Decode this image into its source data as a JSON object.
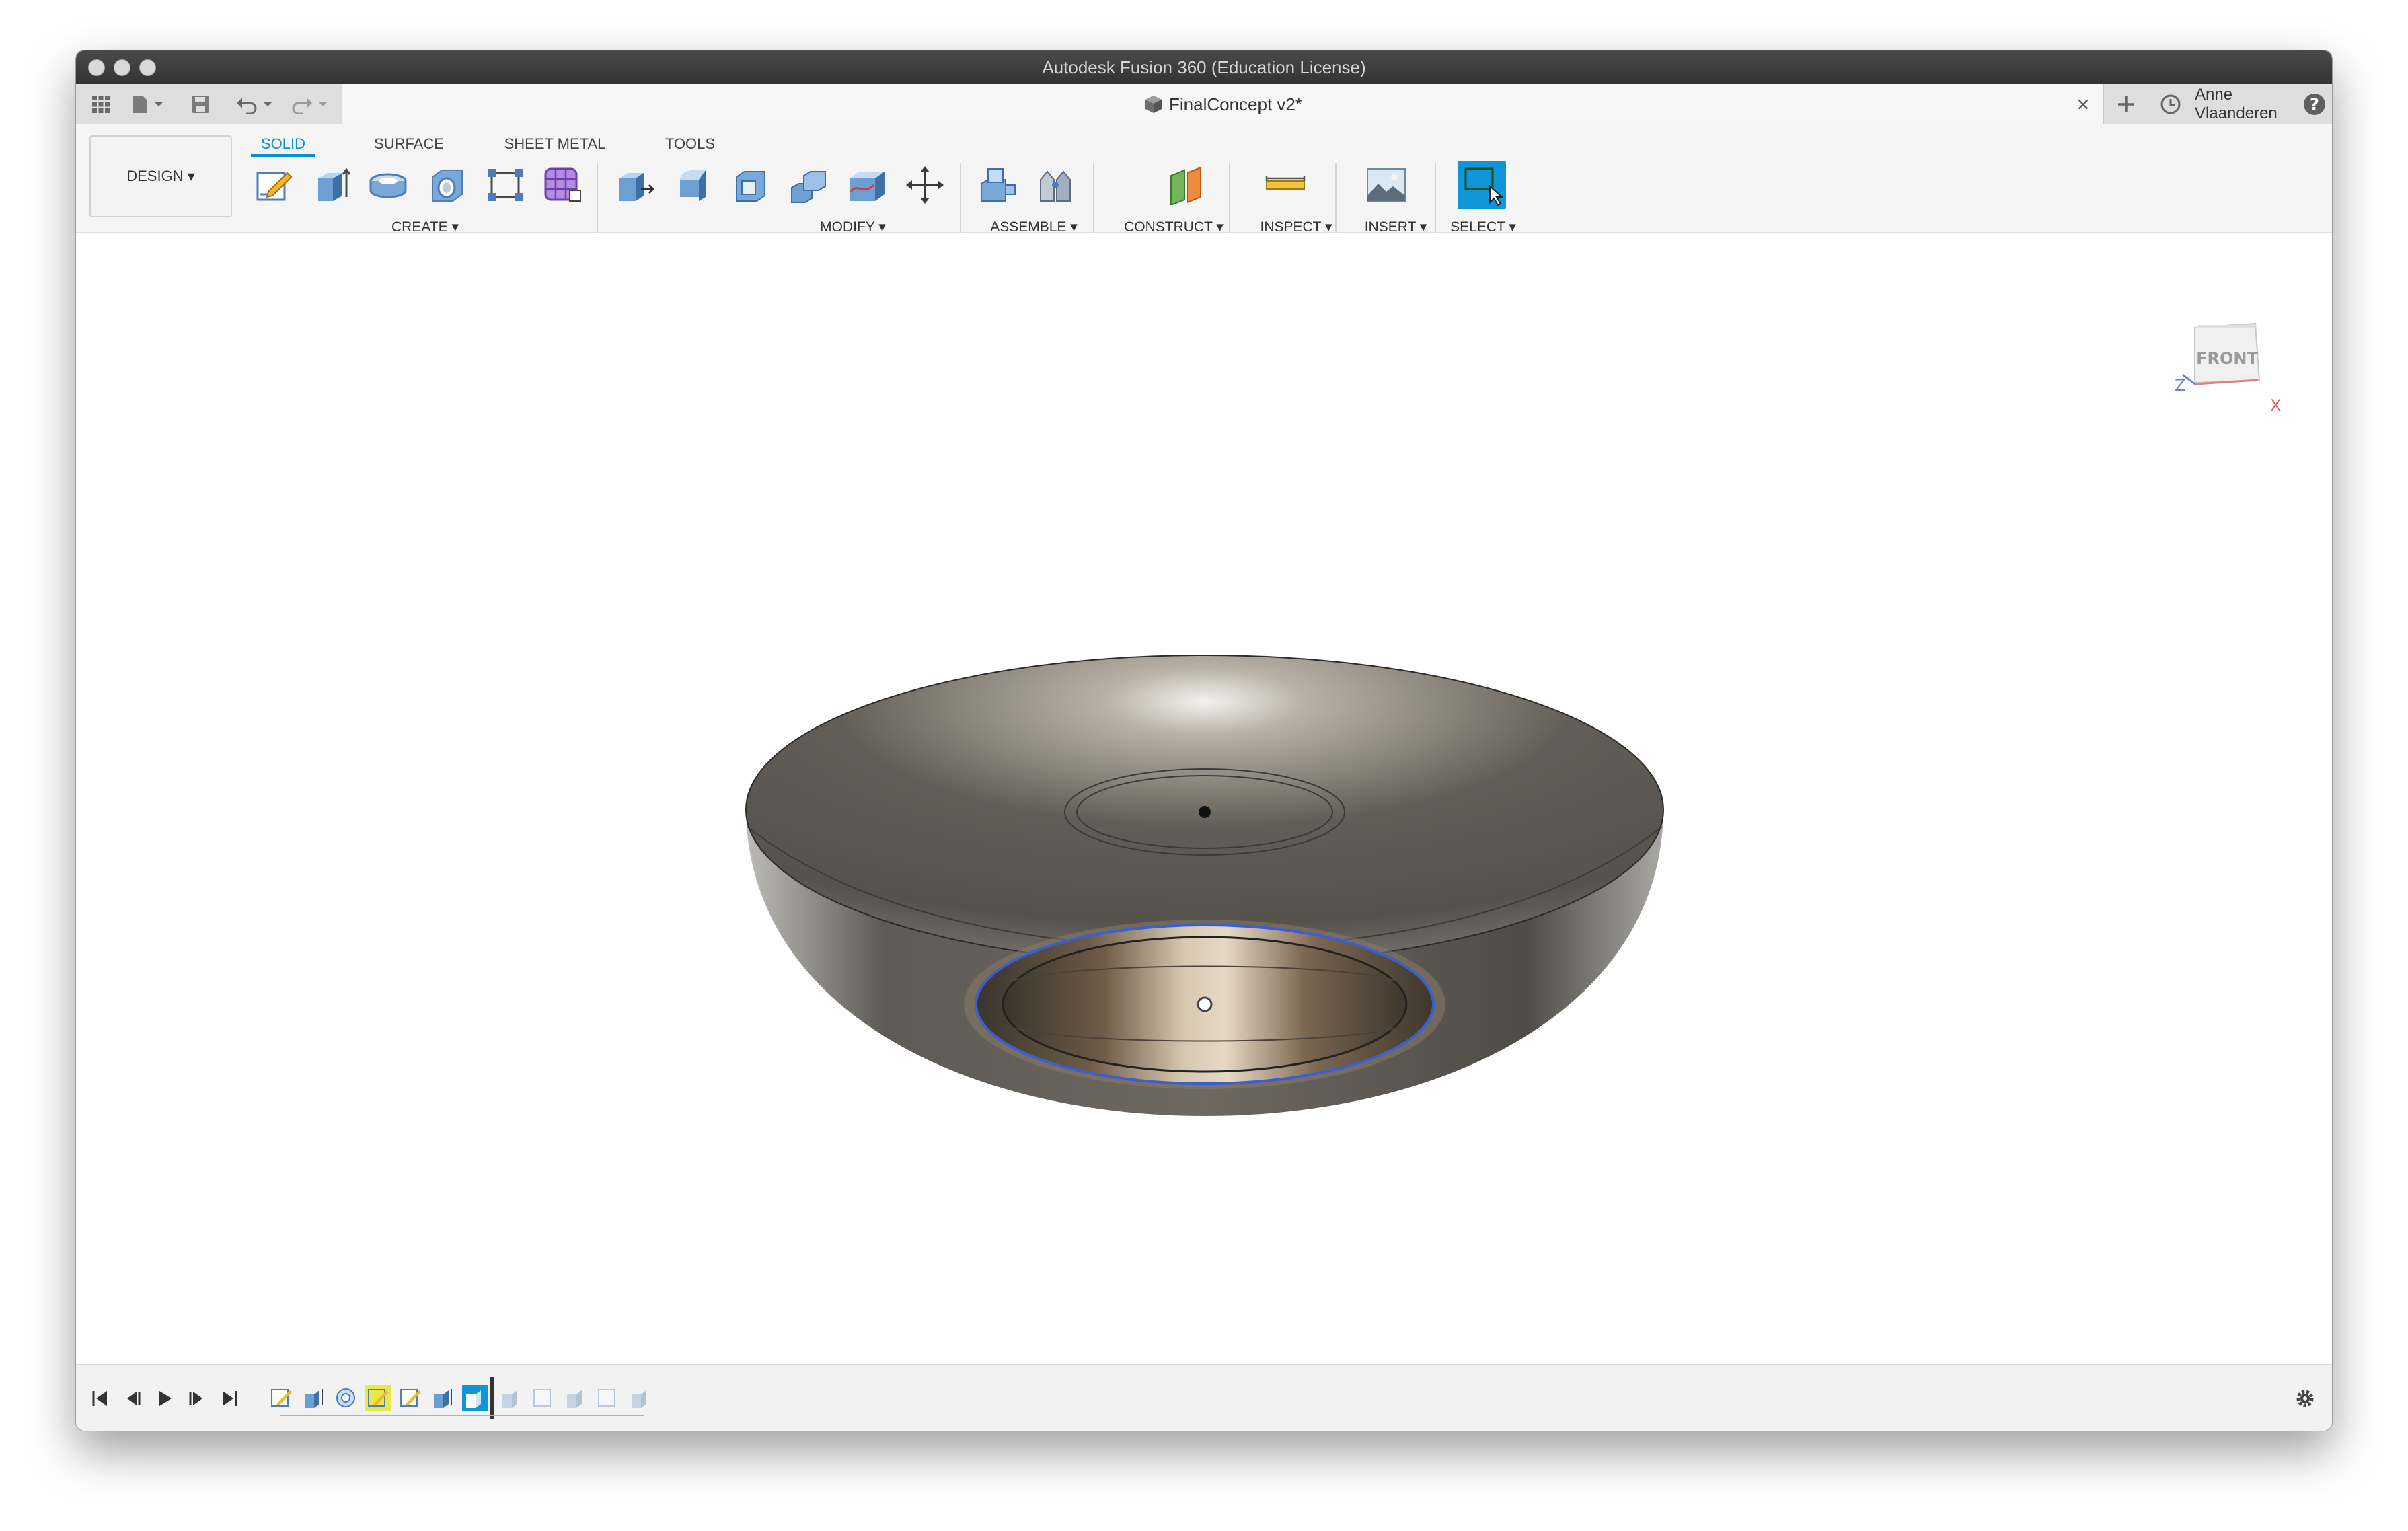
{
  "window": {
    "title": "Autodesk Fusion 360 (Education License)"
  },
  "document": {
    "name": "FinalConcept v2*",
    "close_glyph": "×"
  },
  "user": {
    "name": "Anne Vlaanderen"
  },
  "workspace": {
    "label": "DESIGN ▾"
  },
  "ribbon": {
    "tabs": [
      {
        "label": "SOLID",
        "active": true
      },
      {
        "label": "SURFACE",
        "active": false
      },
      {
        "label": "SHEET METAL",
        "active": false
      },
      {
        "label": "TOOLS",
        "active": false
      }
    ],
    "groups": [
      {
        "label": "CREATE ▾"
      },
      {
        "label": "MODIFY ▾"
      },
      {
        "label": "ASSEMBLE ▾"
      },
      {
        "label": "CONSTRUCT ▾"
      },
      {
        "label": "INSPECT ▾"
      },
      {
        "label": "INSERT ▾"
      },
      {
        "label": "SELECT ▾"
      }
    ]
  },
  "viewcube": {
    "face": "FRONT",
    "axis_x": "X",
    "axis_z": "Z"
  },
  "colors": {
    "accent": "#0a8fd0",
    "select_active": "#0f96d8",
    "highlight_feature": "#e8e84a"
  },
  "icons": [
    "apps-grid-icon",
    "file-icon",
    "save-icon",
    "undo-icon",
    "redo-icon",
    "document-cube-icon",
    "new-tab-icon",
    "job-status-clock-icon",
    "help-icon",
    "settings-gear-icon"
  ]
}
